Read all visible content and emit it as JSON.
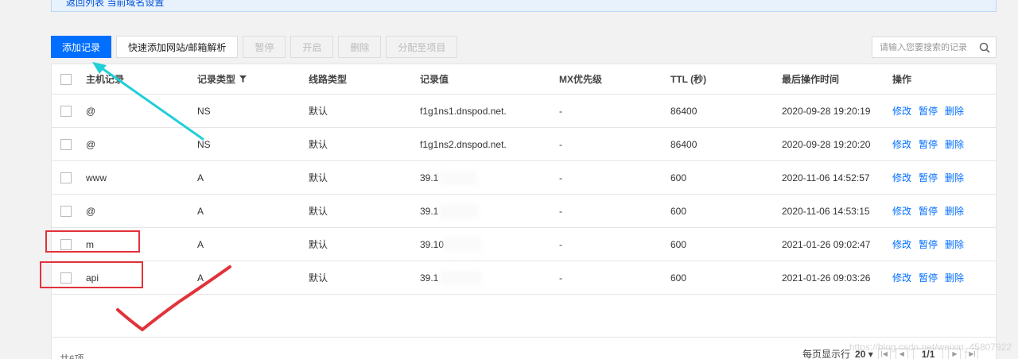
{
  "notice": {
    "text": "返回列表 当前域名设置"
  },
  "toolbar": {
    "add": "添加记录",
    "quick_add": "快速添加网站/邮箱解析",
    "pause": "暂停",
    "enable": "开启",
    "delete": "删除",
    "assign": "分配至项目"
  },
  "search": {
    "placeholder": "请输入您要搜索的记录",
    "icon": "search-icon"
  },
  "table": {
    "headers": {
      "host": "主机记录",
      "type": "记录类型",
      "line": "线路类型",
      "value": "记录值",
      "mx": "MX优先级",
      "ttl": "TTL (秒)",
      "time": "最后操作时间",
      "ops": "操作"
    },
    "rows": [
      {
        "host": "@",
        "type": "NS",
        "line": "默认",
        "value": "f1g1ns1.dnspod.net.",
        "mx": "-",
        "ttl": "86400",
        "time": "2020-09-28 19:20:19"
      },
      {
        "host": "@",
        "type": "NS",
        "line": "默认",
        "value": "f1g1ns2.dnspod.net.",
        "mx": "-",
        "ttl": "86400",
        "time": "2020-09-28 19:20:20"
      },
      {
        "host": "www",
        "type": "A",
        "line": "默认",
        "value": "39.1",
        "mx": "-",
        "ttl": "600",
        "time": "2020-11-06 14:52:57"
      },
      {
        "host": "@",
        "type": "A",
        "line": "默认",
        "value": "39.1",
        "mx": "-",
        "ttl": "600",
        "time": "2020-11-06 14:53:15"
      },
      {
        "host": "m",
        "type": "A",
        "line": "默认",
        "value": "39.10",
        "mx": "-",
        "ttl": "600",
        "time": "2021-01-26 09:02:47"
      },
      {
        "host": "api",
        "type": "A",
        "line": "默认",
        "value": "39.1",
        "mx": "-",
        "ttl": "600",
        "time": "2021-01-26 09:03:26"
      }
    ],
    "ops": {
      "edit": "修改",
      "pause": "暂停",
      "delete": "删除"
    }
  },
  "footer": {
    "total": "共6项",
    "per_page_label": "每页显示行",
    "per_page": "20",
    "page": "1/1"
  },
  "watermark": "https://blog.csdn.net/weixin_45807922",
  "colors": {
    "primary": "#006eff",
    "annotation_red": "#e2323a",
    "arrow_cyan": "#21cfd8"
  }
}
